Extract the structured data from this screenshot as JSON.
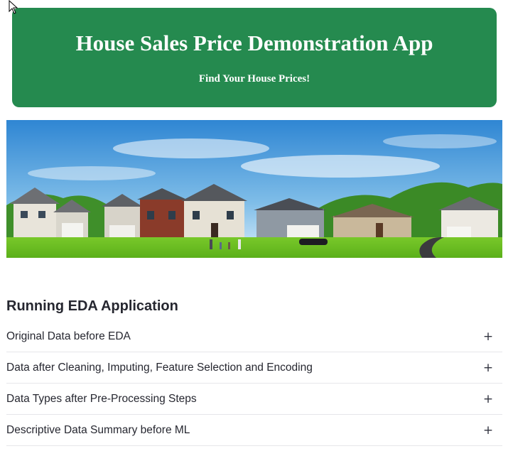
{
  "banner": {
    "title": "House Sales Price Demonstration App",
    "subtitle": "Find Your House Prices!",
    "background_color": "#258a4f"
  },
  "hero_image": {
    "subject": "row of suburban houses on green lawn with family walking"
  },
  "eda": {
    "heading": "Running EDA Application",
    "expanders": [
      {
        "label": "Original Data before EDA",
        "toggle_icon": "+"
      },
      {
        "label": "Data after Cleaning, Imputing, Feature Selection and Encoding",
        "toggle_icon": "+"
      },
      {
        "label": "Data Types after Pre-Processing Steps",
        "toggle_icon": "+"
      },
      {
        "label": "Descriptive Data Summary before ML",
        "toggle_icon": "+"
      }
    ]
  }
}
